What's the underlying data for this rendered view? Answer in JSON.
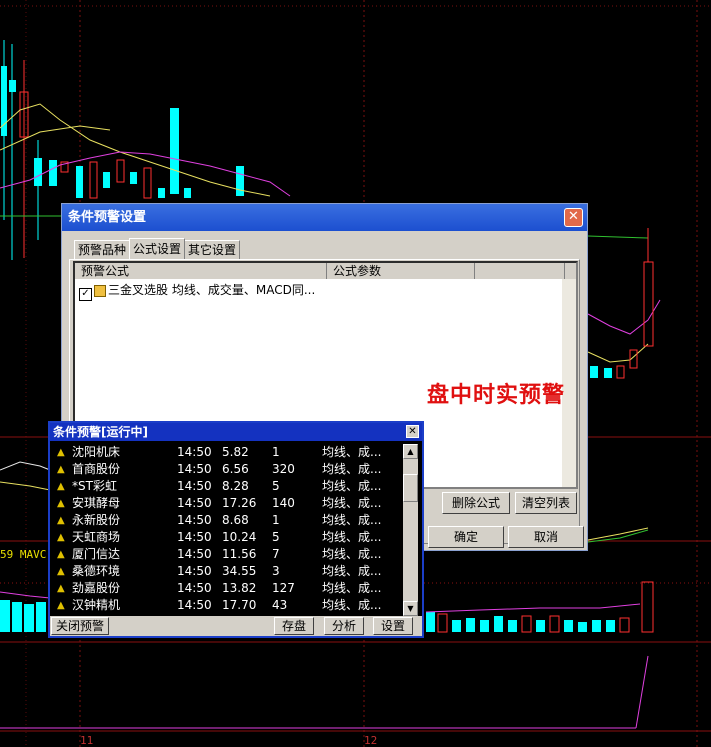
{
  "chart": {
    "ma_label": "59 MAVC",
    "x_labels": [
      "11",
      "12"
    ]
  },
  "main_dialog": {
    "title": "条件预警设置",
    "close": "✕",
    "tabs": [
      "预警品种",
      "公式设置",
      "其它设置"
    ],
    "active_tab": 1,
    "columns": [
      "预警公式",
      "公式参数"
    ],
    "formula_row": {
      "checked": true,
      "name": "三金叉选股",
      "params": "均线、成交量、MACD同..."
    },
    "watermark": "盘中时实预警",
    "buttons": {
      "delete": "删除公式",
      "clear": "清空列表",
      "ok": "确定",
      "cancel": "取消"
    }
  },
  "alert_window": {
    "title": "条件预警[运行中]",
    "rows": [
      {
        "name": "沈阳机床",
        "time": "14:50",
        "price": "5.82",
        "vol": "1",
        "reason": "均线、成..."
      },
      {
        "name": "首商股份",
        "time": "14:50",
        "price": "6.56",
        "vol": "320",
        "reason": "均线、成..."
      },
      {
        "name": "*ST彩虹",
        "time": "14:50",
        "price": "8.28",
        "vol": "5",
        "reason": "均线、成..."
      },
      {
        "name": "安琪酵母",
        "time": "14:50",
        "price": "17.26",
        "vol": "140",
        "reason": "均线、成..."
      },
      {
        "name": "永新股份",
        "time": "14:50",
        "price": "8.68",
        "vol": "1",
        "reason": "均线、成..."
      },
      {
        "name": "天虹商场",
        "time": "14:50",
        "price": "10.24",
        "vol": "5",
        "reason": "均线、成..."
      },
      {
        "name": "厦门信达",
        "time": "14:50",
        "price": "11.56",
        "vol": "7",
        "reason": "均线、成..."
      },
      {
        "name": "桑德环境",
        "time": "14:50",
        "price": "34.55",
        "vol": "3",
        "reason": "均线、成..."
      },
      {
        "name": "劲嘉股份",
        "time": "14:50",
        "price": "13.82",
        "vol": "127",
        "reason": "均线、成..."
      },
      {
        "name": "汉钟精机",
        "time": "14:50",
        "price": "17.70",
        "vol": "43",
        "reason": "均线、成..."
      }
    ],
    "buttons": {
      "close_alert": "关闭预警",
      "save": "存盘",
      "analyze": "分析",
      "settings": "设置"
    }
  },
  "colors": {
    "up_candle": "#ff3030",
    "down_candle": "#00ffff",
    "ma_magenta": "#e040e0",
    "ma_yellow": "#e8e060",
    "ma_green": "#30c030",
    "axis_red": "#8a1010",
    "title_blue": "#1432c0"
  }
}
